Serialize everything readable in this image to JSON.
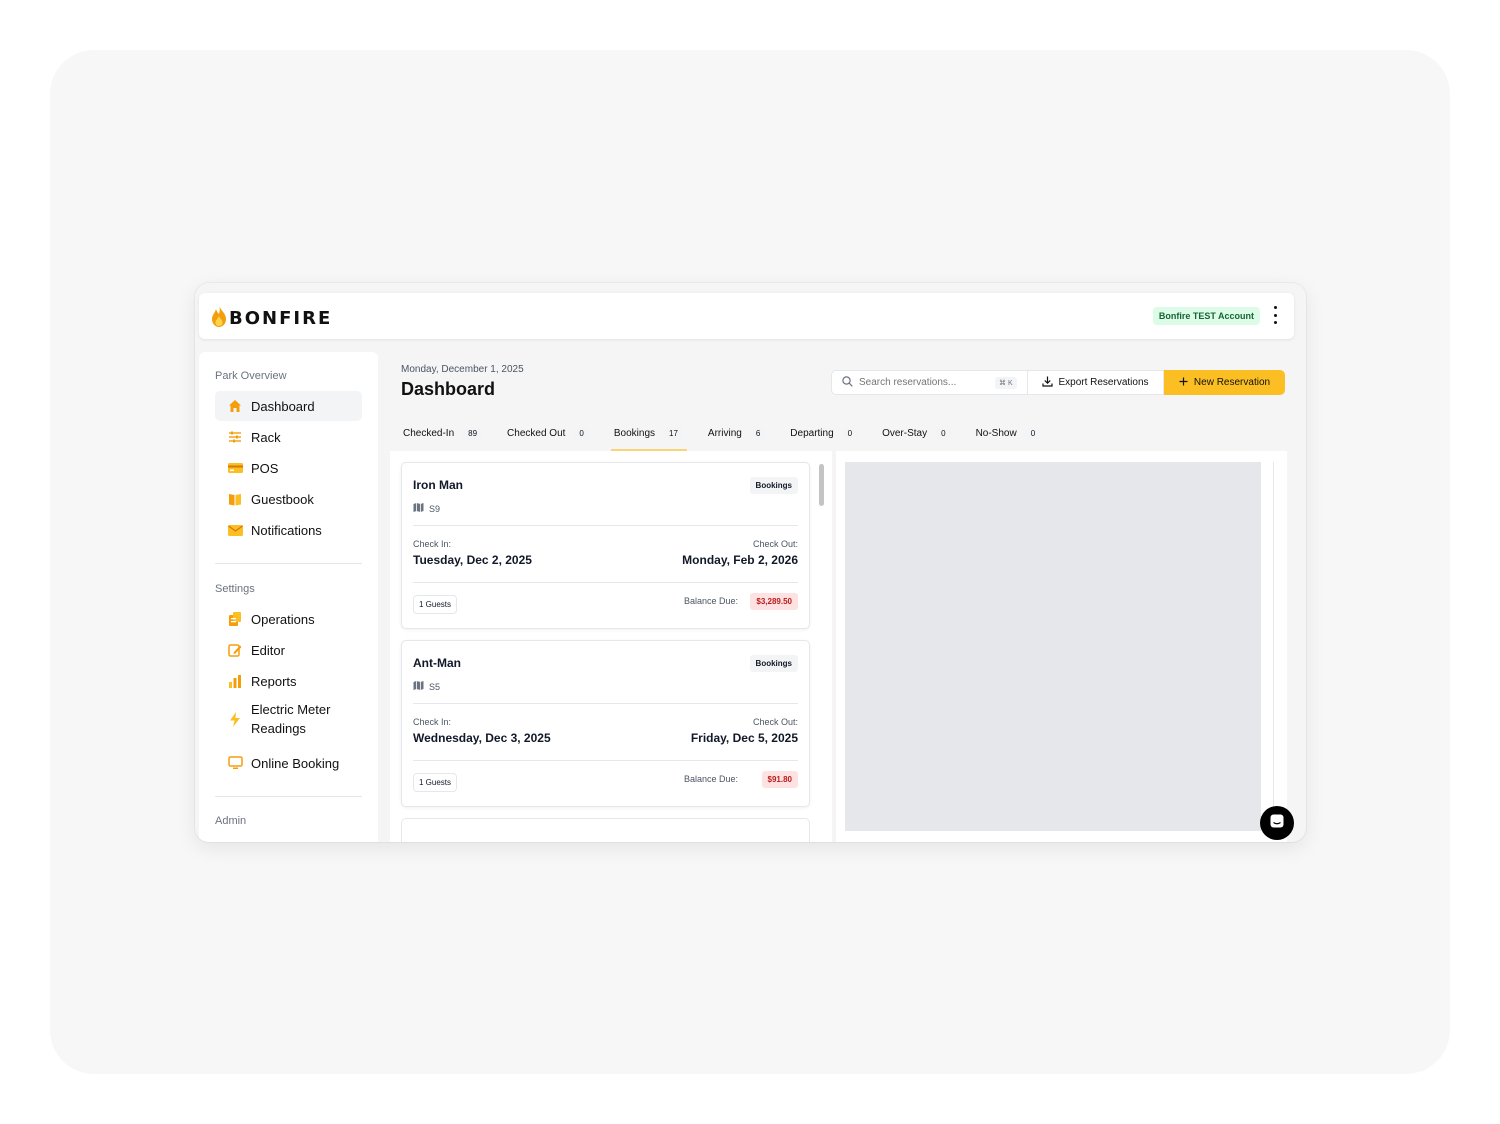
{
  "app": {
    "brand": "BONFIRE",
    "account": "Bonfire TEST Account"
  },
  "sidebar": {
    "sections": [
      {
        "title": "Park Overview"
      },
      {
        "title": "Settings"
      },
      {
        "title": "Admin"
      }
    ],
    "items": [
      {
        "label": "Dashboard",
        "icon": "home-icon"
      },
      {
        "label": "Rack",
        "icon": "sliders-icon"
      },
      {
        "label": "POS",
        "icon": "credit-card-icon"
      },
      {
        "label": "Guestbook",
        "icon": "book-icon"
      },
      {
        "label": "Notifications",
        "icon": "envelope-icon"
      },
      {
        "label": "Operations",
        "icon": "clipboard-icon"
      },
      {
        "label": "Editor",
        "icon": "pencil-square-icon"
      },
      {
        "label": "Reports",
        "icon": "bar-chart-icon"
      },
      {
        "label": "Electric Meter Readings",
        "icon": "lightning-icon"
      },
      {
        "label": "Online Booking",
        "icon": "monitor-icon"
      }
    ]
  },
  "header": {
    "date": "Monday, December 1, 2025",
    "title": "Dashboard",
    "search_placeholder": "Search reservations...",
    "search_shortcut": "⌘ K",
    "export_label": "Export Reservations",
    "new_label": "New Reservation"
  },
  "tabs": [
    {
      "label": "Checked-In",
      "count": "89"
    },
    {
      "label": "Checked Out",
      "count": "0"
    },
    {
      "label": "Bookings",
      "count": "17"
    },
    {
      "label": "Arriving",
      "count": "6"
    },
    {
      "label": "Departing",
      "count": "0"
    },
    {
      "label": "Over-Stay",
      "count": "0"
    },
    {
      "label": "No-Show",
      "count": "0"
    }
  ],
  "active_tab": "Bookings",
  "reservations": [
    {
      "name": "Iron Man",
      "status": "Bookings",
      "site": "S9",
      "check_in_label": "Check In:",
      "check_in": "Tuesday, Dec 2, 2025",
      "check_out_label": "Check Out:",
      "check_out": "Monday, Feb 2, 2026",
      "guests": "1 Guests",
      "balance_label": "Balance Due:",
      "balance": "$3,289.50"
    },
    {
      "name": "Ant-Man",
      "status": "Bookings",
      "site": "S5",
      "check_in_label": "Check In:",
      "check_in": "Wednesday, Dec 3, 2025",
      "check_out_label": "Check Out:",
      "check_out": "Friday, Dec 5, 2025",
      "guests": "1 Guests",
      "balance_label": "Balance Due:",
      "balance": "$91.80"
    }
  ],
  "colors": {
    "accent": "#fbbf24",
    "account_badge_bg": "#dcfce7",
    "balance_red": "#b91c1c"
  }
}
